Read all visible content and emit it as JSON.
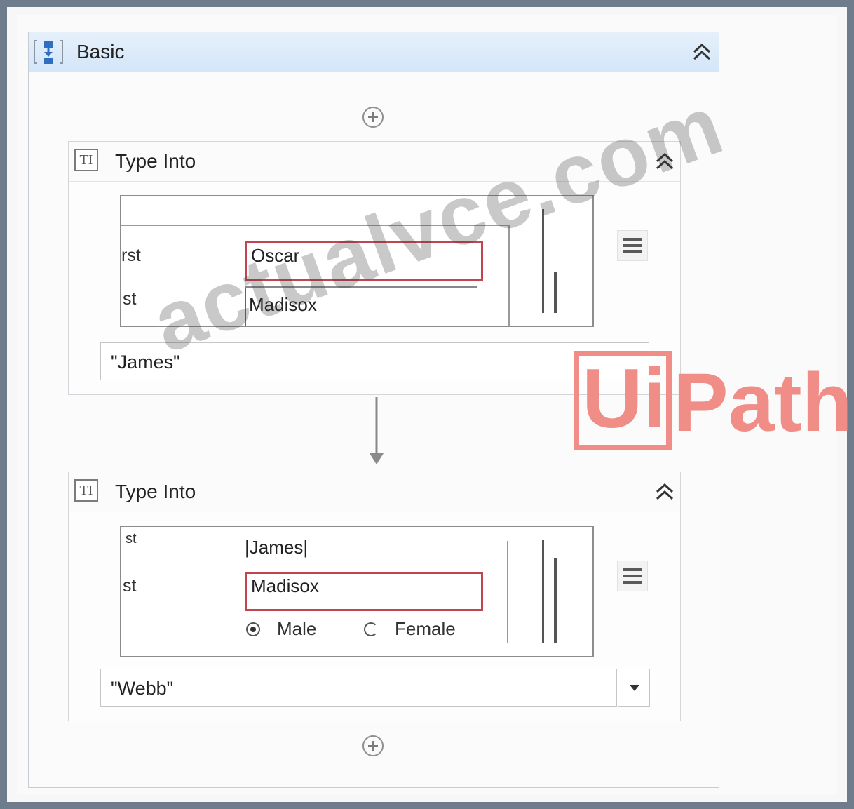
{
  "sequence": {
    "title": "Basic",
    "icon": "sequence-icon",
    "collapse_icon": "chevron-double-up-icon"
  },
  "activities": [
    {
      "title": "Type Into",
      "icon": "type-into-icon",
      "preview": {
        "label1": "rst",
        "field1": "Oscar",
        "label2": "st",
        "field2": "Madisox"
      },
      "text_value": "\"James\""
    },
    {
      "title": "Type Into",
      "icon": "type-into-icon",
      "preview": {
        "label0": "st",
        "field0": "|James|",
        "label1": "st",
        "field1": "Madisox",
        "radio_male": "Male",
        "radio_female": "Female"
      },
      "text_value": "\"Webb\""
    }
  ],
  "watermark": {
    "text": "actualvce.com",
    "logo_ui": "Ui",
    "logo_path": "Path",
    "color": "#f08d86"
  }
}
